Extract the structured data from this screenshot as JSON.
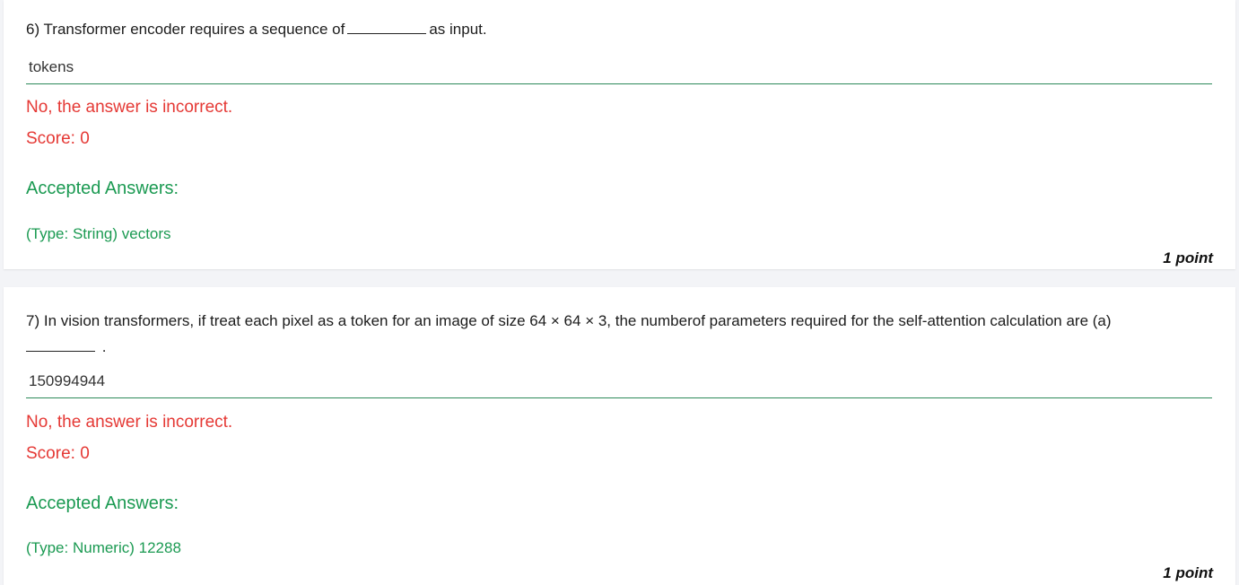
{
  "questions": [
    {
      "number": "6)",
      "text_before": "Transformer encoder requires a sequence of",
      "text_after": "as input.",
      "answer_value": "tokens",
      "status": "No, the answer is incorrect.",
      "score": "Score: 0",
      "accepted_header": "Accepted Answers:",
      "accepted_value": "(Type: String) vectors",
      "points": "1 point"
    },
    {
      "number": "7)",
      "text_before": "In vision transformers, if treat each pixel as a token for an image of size 64 × 64 × 3, the numberof parameters required for the self-attention calculation are (a)",
      "text_after": ".",
      "answer_value": "150994944",
      "status": "No, the answer is incorrect.",
      "score": "Score: 0",
      "accepted_header": "Accepted Answers:",
      "accepted_value": "(Type: Numeric) 12288",
      "points": "1 point"
    }
  ]
}
